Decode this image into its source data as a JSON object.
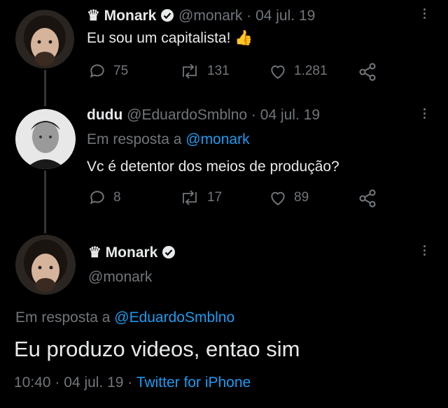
{
  "tweets": [
    {
      "crown": "♛",
      "name": "Monark",
      "handle": "@monark",
      "sep": "·",
      "date": "04 jul. 19",
      "text": "Eu sou um capitalista! 👍",
      "replies": "75",
      "retweets": "131",
      "likes": "1.281"
    },
    {
      "name": "dudu",
      "handle": "@EduardoSmblno",
      "sep": "·",
      "date": "04 jul. 19",
      "reply_prefix": "Em resposta a",
      "reply_to": "@monark",
      "text": "Vc é detentor dos meios de produção?",
      "replies": "8",
      "retweets": "17",
      "likes": "89"
    }
  ],
  "main": {
    "crown": "♛",
    "name": "Monark",
    "handle": "@monark",
    "reply_prefix": "Em resposta a",
    "reply_to": "@EduardoSmblno",
    "text": "Eu produzo videos, entao sim",
    "time": "10:40",
    "sep1": "·",
    "date": "04 jul. 19",
    "sep2": "·",
    "source": "Twitter for iPhone"
  },
  "colors": {
    "background": "#000000",
    "text": "#e7e9ea",
    "secondary": "#71767b",
    "accent": "#1d9bf0"
  }
}
